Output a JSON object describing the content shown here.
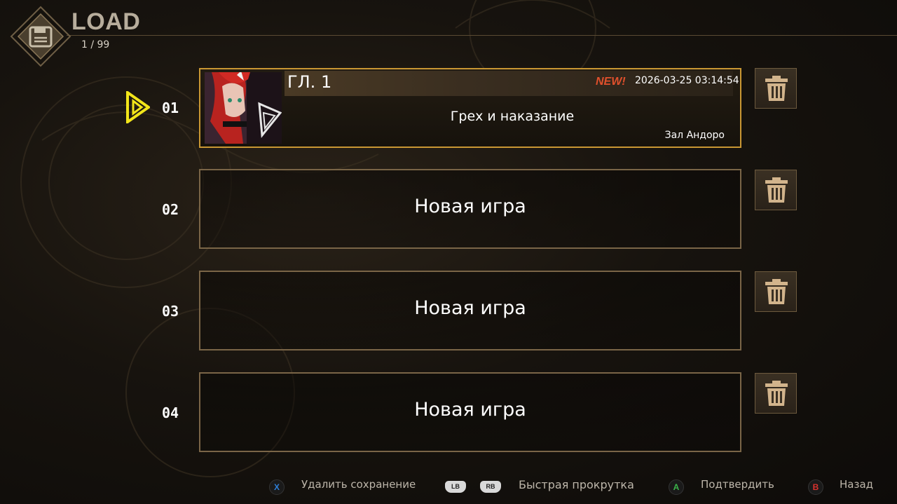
{
  "header": {
    "title": "LOAD",
    "counter": "1 / 99"
  },
  "slots": [
    {
      "number": "01",
      "selected": true,
      "chapter": "ГЛ. 1",
      "new_tag": "NEW!",
      "timestamp": "2026-03-25 03:14:54",
      "save_name": "Грех и наказание",
      "location": "Зал Андоро"
    },
    {
      "number": "02",
      "label": "Новая игра"
    },
    {
      "number": "03",
      "label": "Новая игра"
    },
    {
      "number": "04",
      "label": "Новая игра"
    }
  ],
  "footer": {
    "delete": {
      "button": "X",
      "label": "Удалить сохранение"
    },
    "scroll": {
      "button_left": "LB",
      "button_right": "RB",
      "label": "Быстрая прокрутка"
    },
    "confirm": {
      "button": "A",
      "label": "Подтвердить"
    },
    "back": {
      "button": "B",
      "label": "Назад"
    }
  },
  "colors": {
    "accent_gold": "#c99733",
    "cursor_yellow": "#f2e51a",
    "new_tag": "#e0502c",
    "btn_x": "#2e7fd8",
    "btn_a": "#3bb54a",
    "btn_b": "#d8322e"
  }
}
